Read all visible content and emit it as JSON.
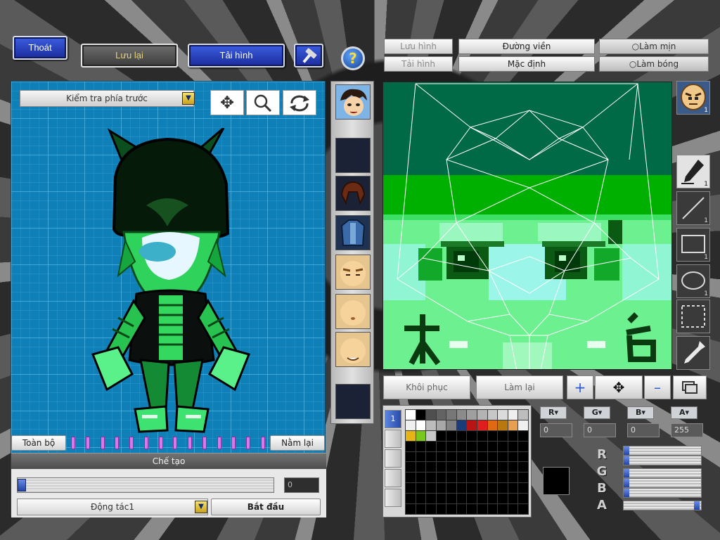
{
  "top_buttons": {
    "exit": "Thoát",
    "save": "Lưu lại",
    "load": "Tải hình",
    "help": "?"
  },
  "left_panel": {
    "view_select": "Kiểm tra phía trước",
    "tools": [
      "move-icon",
      "zoom-icon",
      "rotate-icon"
    ],
    "all_button": "Toàn bộ",
    "lie_button": "Nằm lại",
    "frames": 14,
    "create_title": "Chế tạo",
    "frame_value": "0",
    "action_select": "Động tác1",
    "start_button": "Bắt đầu"
  },
  "editor": {
    "tab_save": "Lưu hình",
    "tab_load": "Tải hình",
    "outline_select": "Đường viền",
    "default_select": "Mặc định",
    "smooth_option": "Làm mịn",
    "shade_option": "Làm bóng",
    "restore_button": "Khôi phục",
    "redo_button": "Làm lại"
  },
  "tool_counts": {
    "face_badge": "1",
    "pen": "1",
    "line": "1",
    "rect": "1",
    "ellipse": "1"
  },
  "palette": {
    "tab_label": "1",
    "row1": [
      "#ffffff",
      "#000000",
      "#4f4f4f",
      "#636363",
      "#777777",
      "#8b8b8b",
      "#9f9f9f",
      "#b3b3b3",
      "#c7c7c7",
      "#dbdbdb",
      "#efefef",
      "#bdbdbd"
    ],
    "row2": [
      "#f0f0f0",
      "#ffffff",
      "#bcbcbc",
      "#a8a8a8",
      "#828282",
      "#1a3d7a",
      "#b81414",
      "#e01e1e",
      "#e06a14",
      "#b8780e",
      "#e8a050",
      "#f0f0f0"
    ],
    "row3": [
      "#e6b414",
      "#7ac81e",
      "#c8c8c8"
    ]
  },
  "color_channels": {
    "r": "0",
    "g": "0",
    "b": "0",
    "a": "255",
    "current_color": "#000000",
    "r_level": 0,
    "g_level": 0,
    "b_level": 0,
    "a_level": 1
  },
  "accent": {
    "editor_green": "#00c800",
    "grid_blue": "#0f7fb7"
  }
}
